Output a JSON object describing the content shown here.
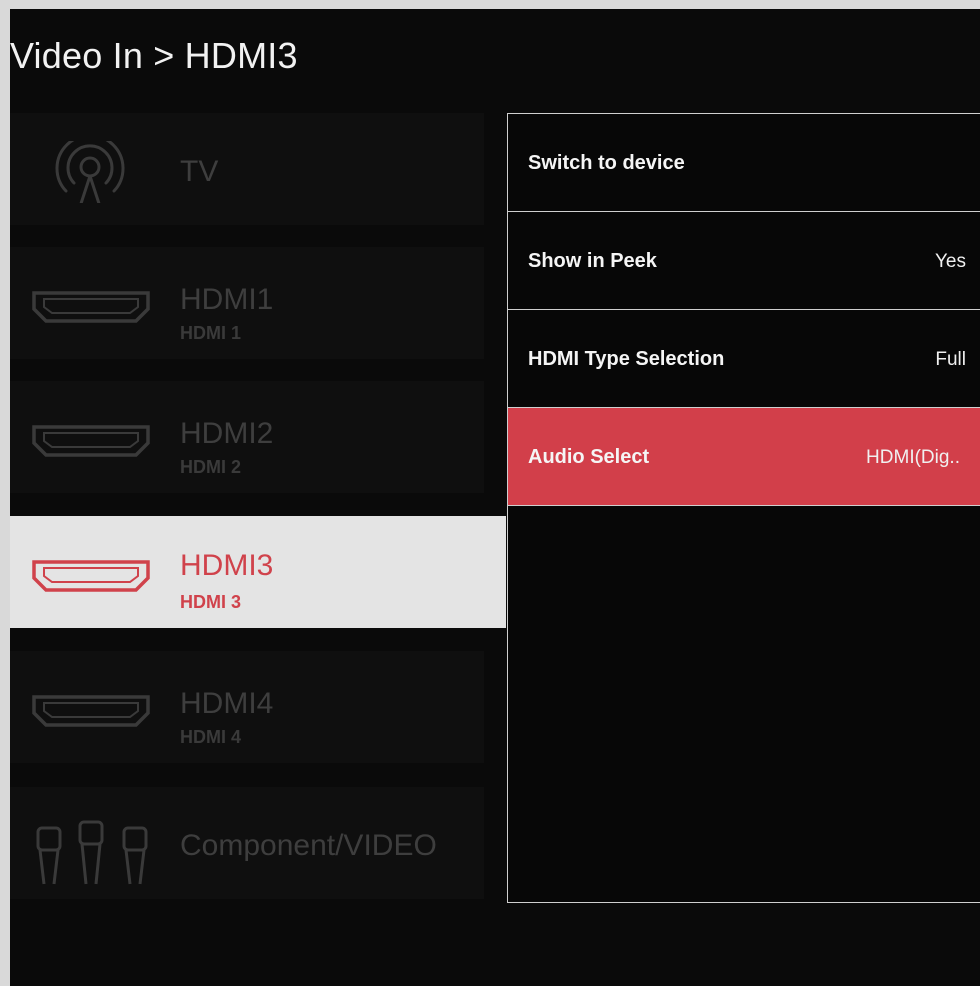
{
  "header": {
    "breadcrumb": "Video In > HDMI3"
  },
  "sources": [
    {
      "name": "TV",
      "icon": "antenna-icon"
    },
    {
      "name": "HDMI1",
      "sub": "HDMI 1",
      "icon": "hdmi-port-icon"
    },
    {
      "name": "HDMI2",
      "sub": "HDMI 2",
      "icon": "hdmi-port-icon"
    },
    {
      "name": "HDMI3",
      "sub": "HDMI 3",
      "icon": "hdmi-port-icon",
      "active": true
    },
    {
      "name": "HDMI4",
      "sub": "HDMI 4",
      "icon": "hdmi-port-icon"
    },
    {
      "name": "Component/VIDEO",
      "icon": "rca-plugs-icon"
    }
  ],
  "options": [
    {
      "label": "Switch to device",
      "value": ""
    },
    {
      "label": "Show in Peek",
      "value": "Yes"
    },
    {
      "label": "HDMI Type Selection",
      "value": "Full"
    },
    {
      "label": "Audio Select",
      "value": "HDMI(Dig..",
      "selected": true
    }
  ],
  "colors": {
    "accent": "#d23f4a",
    "background": "#0a0a0a",
    "active_item_bg": "#e4e4e4",
    "inactive_text": "#3e3e3e"
  }
}
